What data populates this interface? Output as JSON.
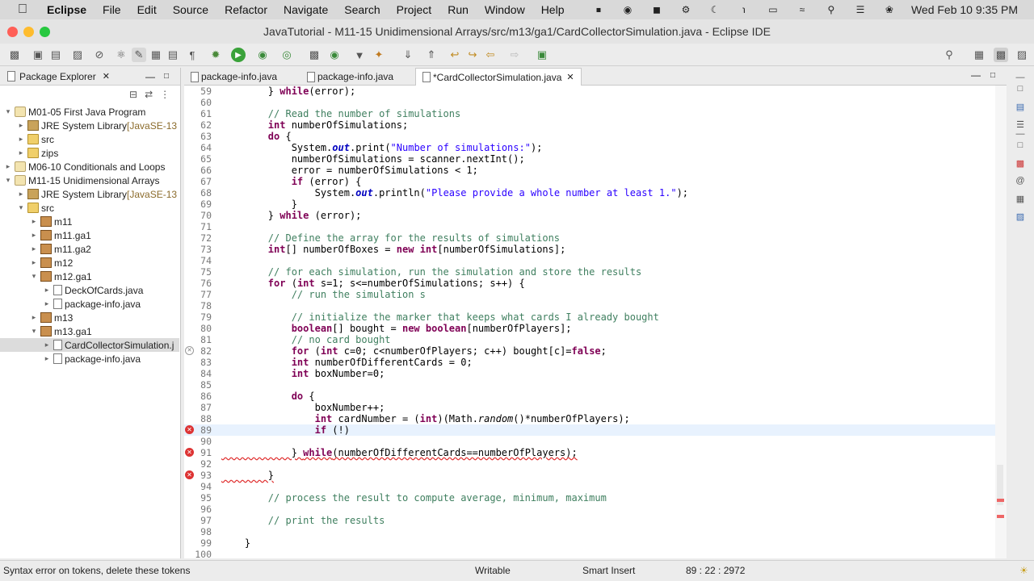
{
  "menubar": {
    "app": "Eclipse",
    "items": [
      "File",
      "Edit",
      "Source",
      "Refactor",
      "Navigate",
      "Search",
      "Project",
      "Run",
      "Window",
      "Help"
    ],
    "clock": "Wed Feb 10  9:35 PM"
  },
  "window": {
    "title": "JavaTutorial - M11-15 Unidimensional Arrays/src/m13/ga1/CardCollectorSimulation.java - Eclipse IDE"
  },
  "package_explorer": {
    "title": "Package Explorer",
    "tree": [
      {
        "label": "M01-05 First Java Program",
        "extra": "",
        "icon": "project",
        "expanded": true
      },
      {
        "label": "JRE System Library ",
        "extra": "[JavaSE-13",
        "icon": "library",
        "expanded": false
      },
      {
        "label": "src",
        "extra": "",
        "icon": "folder",
        "expanded": false
      },
      {
        "label": "zips",
        "extra": "",
        "icon": "folder",
        "expanded": false
      },
      {
        "label": "M06-10 Conditionals and Loops",
        "extra": "",
        "icon": "project",
        "expanded": false
      },
      {
        "label": "M11-15 Unidimensional Arrays",
        "extra": "",
        "icon": "project",
        "expanded": true
      },
      {
        "label": "JRE System Library ",
        "extra": "[JavaSE-13",
        "icon": "library",
        "expanded": false
      },
      {
        "label": "src",
        "extra": "",
        "icon": "folder",
        "expanded": true
      },
      {
        "label": "m11",
        "extra": "",
        "icon": "package",
        "expanded": false
      },
      {
        "label": "m11.ga1",
        "extra": "",
        "icon": "package",
        "expanded": false
      },
      {
        "label": "m11.ga2",
        "extra": "",
        "icon": "package",
        "expanded": false
      },
      {
        "label": "m12",
        "extra": "",
        "icon": "package",
        "expanded": false
      },
      {
        "label": "m12.ga1",
        "extra": "",
        "icon": "package",
        "expanded": true
      },
      {
        "label": "DeckOfCards.java",
        "extra": "",
        "icon": "file",
        "expanded": false
      },
      {
        "label": "package-info.java",
        "extra": "",
        "icon": "file",
        "expanded": false
      },
      {
        "label": "m13",
        "extra": "",
        "icon": "package",
        "expanded": false
      },
      {
        "label": "m13.ga1",
        "extra": "",
        "icon": "package",
        "expanded": true
      },
      {
        "label": "CardCollectorSimulation.j",
        "extra": "",
        "icon": "file",
        "expanded": false
      },
      {
        "label": "package-info.java",
        "extra": "",
        "icon": "file",
        "expanded": false
      }
    ]
  },
  "editor": {
    "tabs": [
      "package-info.java",
      "package-info.java",
      "*CardCollectorSimulation.java"
    ],
    "lines": [
      {
        "n": "59",
        "t": "        } while(error);"
      },
      {
        "n": "60",
        "t": ""
      },
      {
        "n": "61",
        "t": "        // Read the number of simulations"
      },
      {
        "n": "62",
        "t": "        int numberOfSimulations;"
      },
      {
        "n": "63",
        "t": "        do {"
      },
      {
        "n": "64",
        "t": "            System.out.print(\"Number of simulations:\");"
      },
      {
        "n": "65",
        "t": "            numberOfSimulations = scanner.nextInt();"
      },
      {
        "n": "66",
        "t": "            error = numberOfSimulations < 1;"
      },
      {
        "n": "67",
        "t": "            if (error) {"
      },
      {
        "n": "68",
        "t": "                System.out.println(\"Please provide a whole number at least 1.\");"
      },
      {
        "n": "69",
        "t": "            }"
      },
      {
        "n": "70",
        "t": "        } while (error);"
      },
      {
        "n": "71",
        "t": ""
      },
      {
        "n": "72",
        "t": "        // Define the array for the results of simulations"
      },
      {
        "n": "73",
        "t": "        int[] numberOfBoxes = new int[numberOfSimulations];"
      },
      {
        "n": "74",
        "t": ""
      },
      {
        "n": "75",
        "t": "        // for each simulation, run the simulation and store the results"
      },
      {
        "n": "76",
        "t": "        for (int s=1; s<=numberOfSimulations; s++) {"
      },
      {
        "n": "77",
        "t": "            // run the simulation s"
      },
      {
        "n": "78",
        "t": ""
      },
      {
        "n": "79",
        "t": "            // initialize the marker that keeps what cards I already bought"
      },
      {
        "n": "80",
        "t": "            boolean[] bought = new boolean[numberOfPlayers];"
      },
      {
        "n": "81",
        "t": "            // no card bought"
      },
      {
        "n": "82",
        "t": "            for (int c=0; c<numberOfPlayers; c++) bought[c]=false;"
      },
      {
        "n": "83",
        "t": "            int numberOfDifferentCards = 0;"
      },
      {
        "n": "84",
        "t": "            int boxNumber=0;"
      },
      {
        "n": "85",
        "t": ""
      },
      {
        "n": "86",
        "t": "            do {"
      },
      {
        "n": "87",
        "t": "                boxNumber++;"
      },
      {
        "n": "88",
        "t": "                int cardNumber = (int)(Math.random()*numberOfPlayers);"
      },
      {
        "n": "89",
        "t": "                if (!)"
      },
      {
        "n": "90",
        "t": ""
      },
      {
        "n": "91",
        "t": "            } while(numberOfDifferentCards==numberOfPlayers);"
      },
      {
        "n": "92",
        "t": ""
      },
      {
        "n": "93",
        "t": "        }"
      },
      {
        "n": "94",
        "t": ""
      },
      {
        "n": "95",
        "t": "        // process the result to compute average, minimum, maximum"
      },
      {
        "n": "96",
        "t": ""
      },
      {
        "n": "97",
        "t": "        // print the results"
      },
      {
        "n": "98",
        "t": ""
      },
      {
        "n": "99",
        "t": "    }"
      },
      {
        "n": "100",
        "t": ""
      }
    ]
  },
  "status": {
    "message": "Syntax error on tokens, delete these tokens",
    "mode": "Writable",
    "insert": "Smart Insert",
    "position": "89 : 22 : 2972"
  },
  "colors": {
    "keyword": "#7f0055",
    "comment": "#3f7f5f",
    "string": "#2a00ff",
    "error": "#e03030",
    "current_line": "#e8f2fe"
  }
}
